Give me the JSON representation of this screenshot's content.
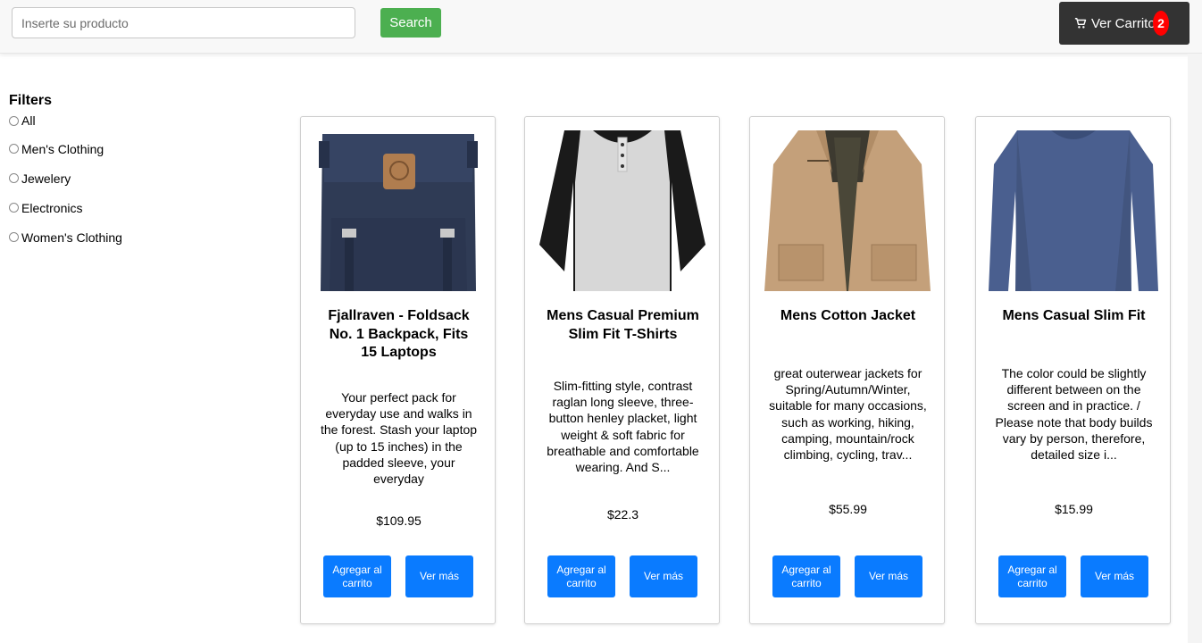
{
  "header": {
    "search_placeholder": "Inserte su producto",
    "search_label": "Search",
    "cart_label": "Ver Carrito",
    "cart_count": "2",
    "colors": {
      "search_button": "#4caf50",
      "cart_button": "#333333",
      "badge": "#ff0000"
    }
  },
  "filters": {
    "title": "Filters",
    "options": [
      "All",
      "Men's Clothing",
      "Jewelery",
      "Electronics",
      "Women's Clothing"
    ]
  },
  "products": [
    {
      "title": "Fjallraven - Foldsack No. 1 Backpack, Fits 15 Laptops",
      "description": "Your perfect pack for everyday use and walks in the forest. Stash your laptop (up to 15 inches) in the padded sleeve, your everyday",
      "price": "$109.95",
      "add_label": "Agregar al carrito",
      "more_label": "Ver más",
      "image": "navy-backpack"
    },
    {
      "title": "Mens Casual Premium Slim Fit T-Shirts",
      "description": "Slim-fitting style, contrast raglan long sleeve, three-button henley placket, light weight & soft fabric for breathable and comfortable wearing. And S...",
      "price": "$22.3",
      "add_label": "Agregar al carrito",
      "more_label": "Ver más",
      "image": "raglan-henley-shirt"
    },
    {
      "title": "Mens Cotton Jacket",
      "description": "great outerwear jackets for Spring/Autumn/Winter, suitable for many occasions, such as working, hiking, camping, mountain/rock climbing, cycling, trav...",
      "price": "$55.99",
      "add_label": "Agregar al carrito",
      "more_label": "Ver más",
      "image": "khaki-jacket"
    },
    {
      "title": "Mens Casual Slim Fit",
      "description": "The color could be slightly different between on the screen and in practice. / Please note that body builds vary by person, therefore, detailed size i...",
      "price": "$15.99",
      "add_label": "Agregar al carrito",
      "more_label": "Ver más",
      "image": "blue-long-sleeve-shirt"
    }
  ],
  "accent_button_color": "#0a7bff"
}
